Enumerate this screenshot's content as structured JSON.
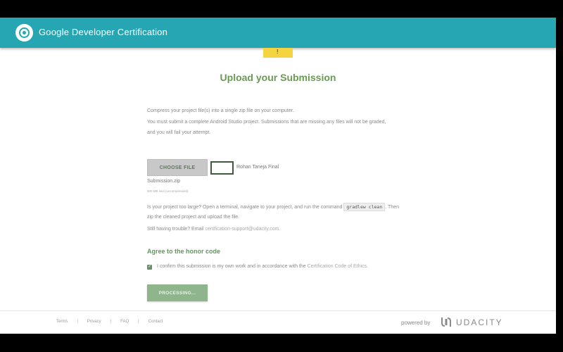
{
  "header": {
    "title": "Google Developer Certification"
  },
  "main": {
    "heading": "Upload your Submission",
    "instructions": [
      "Compress your project file(s) into a single zip file on your computer.",
      "You must submit a complete Android Studio project. Submissions that are missing any files will not be graded,",
      "and you will fail your attempt."
    ],
    "upload": {
      "choose_label": "CHOOSE FILE",
      "file_name_line1": "Rohan Taneja Final",
      "file_name_line2": "Submission.zip",
      "size_note": "500 MB limit (uncompressed)"
    },
    "too_large": {
      "prefix": "Is your project too large? Open a terminal, navigate to your project, and run the command",
      "command": "gradlew clean",
      "suffix": ". Then",
      "line2": "zip the cleaned project and upload the file."
    },
    "trouble": {
      "prefix": "Still having trouble? Email",
      "email": "certification-support@udacity.com",
      "suffix": "."
    },
    "honor": {
      "heading": "Agree to the honor code",
      "checked": true,
      "text": "I confirm this submission is my own work and in accordance with the",
      "link": "Certification Code of Ethics",
      "suffix": "."
    },
    "processing_label": "PROCESSING..."
  },
  "footer": {
    "links": [
      "Terms",
      "Privacy",
      "FAQ",
      "Contact"
    ],
    "powered_by": "powered by",
    "brand": "UDACITY"
  },
  "colors": {
    "header_bg": "#26a6b3",
    "heading_green": "#6a9a56",
    "button_green": "#8fb58d",
    "badge_yellow": "#f5d442"
  }
}
